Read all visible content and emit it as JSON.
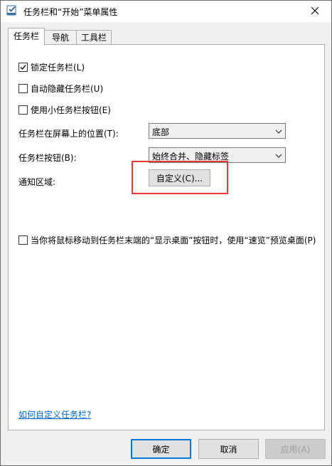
{
  "window": {
    "title": "任务栏和“开始”菜单属性",
    "icon": "taskbar-properties-icon",
    "close_icon": "close-icon"
  },
  "tabs": [
    {
      "label": "任务栏",
      "active": true
    },
    {
      "label": "导航",
      "active": false
    },
    {
      "label": "工具栏",
      "active": false
    }
  ],
  "options": {
    "lock_taskbar": {
      "label": "锁定任务栏(L)",
      "checked": true
    },
    "auto_hide": {
      "label": "自动隐藏任务栏(U)",
      "checked": false
    },
    "small_buttons": {
      "label": "使用小任务栏按钮(E)",
      "checked": false
    },
    "peek": {
      "label": "当你将鼠标移动到任务栏末端的“显示桌面”按钮时，使用“速览”预览桌面(P)",
      "checked": false
    }
  },
  "location": {
    "label": "任务栏在屏幕上的位置(T):",
    "value": "底部"
  },
  "buttons_setting": {
    "label": "任务栏按钮(B):",
    "value": "始终合并、隐藏标签"
  },
  "notification": {
    "label": "通知区域:",
    "customize_label": "自定义(C)..."
  },
  "help_link": "如何自定义任务栏?",
  "footer": {
    "ok": "确定",
    "cancel": "取消",
    "apply": "应用(A)"
  },
  "colors": {
    "highlight": "#e53935",
    "link": "#0066cc",
    "accent": "#0078d7"
  }
}
